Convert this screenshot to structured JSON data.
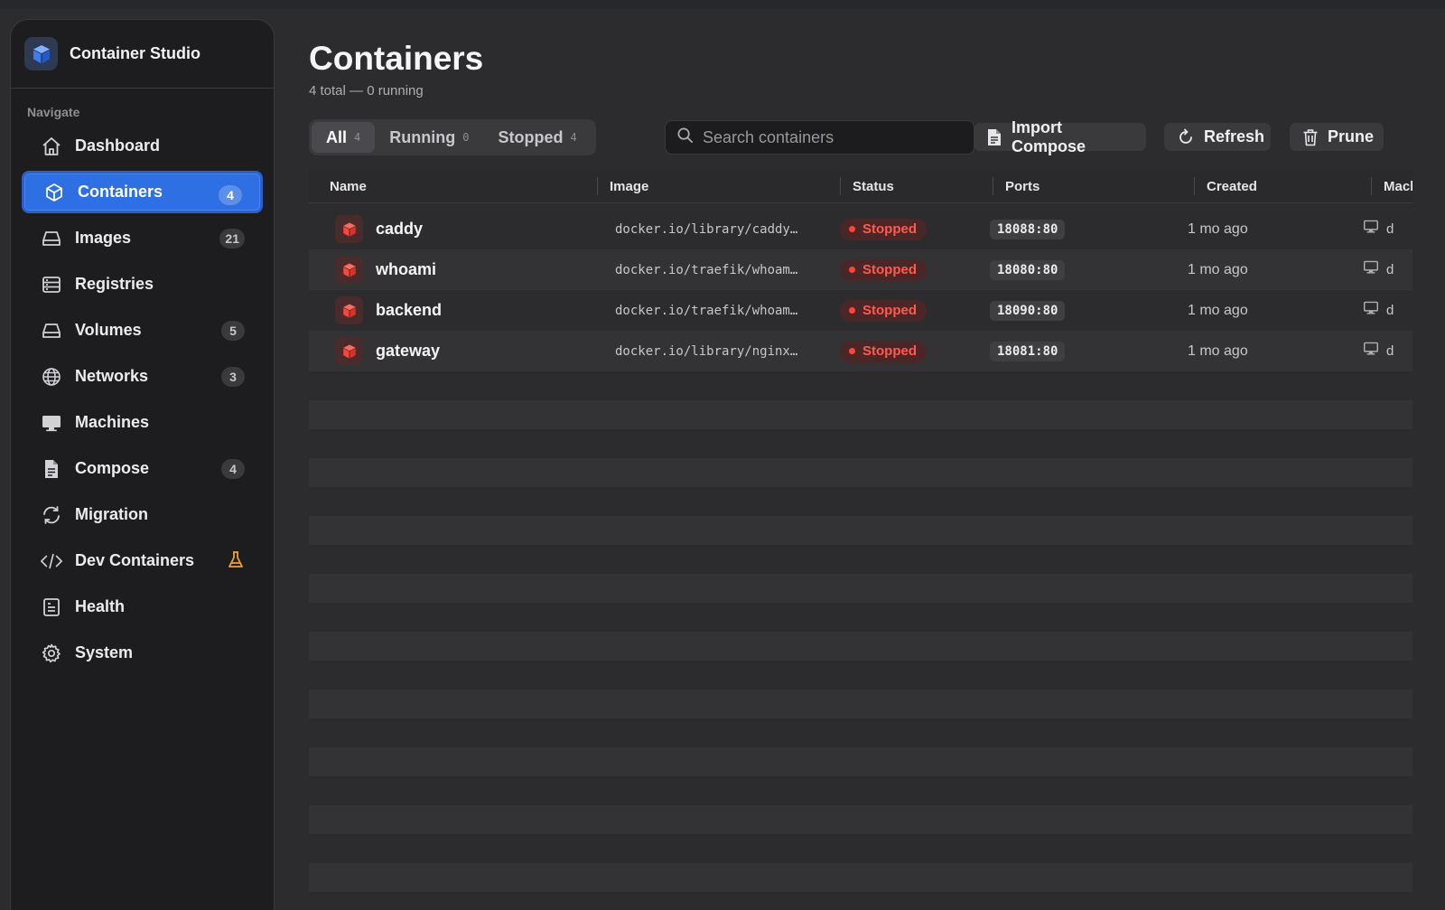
{
  "app": {
    "name": "Container Studio"
  },
  "sidebar": {
    "heading": "Navigate",
    "items": [
      {
        "label": "Dashboard",
        "icon": "house-icon",
        "badge": null
      },
      {
        "label": "Containers",
        "icon": "cube-icon",
        "badge": "4",
        "active": true
      },
      {
        "label": "Images",
        "icon": "drive-icon",
        "badge": "21"
      },
      {
        "label": "Registries",
        "icon": "server-rack-icon",
        "badge": null
      },
      {
        "label": "Volumes",
        "icon": "disk-icon",
        "badge": "5"
      },
      {
        "label": "Networks",
        "icon": "globe-icon",
        "badge": "3"
      },
      {
        "label": "Machines",
        "icon": "monitor-icon",
        "badge": null
      },
      {
        "label": "Compose",
        "icon": "document-icon",
        "badge": "4"
      },
      {
        "label": "Migration",
        "icon": "sync-arrows-icon",
        "badge": null
      },
      {
        "label": "Dev Containers",
        "icon": "code-brackets-icon",
        "badge": null,
        "flag": "flask-icon"
      },
      {
        "label": "Health",
        "icon": "report-icon",
        "badge": null
      },
      {
        "label": "System",
        "icon": "gear-icon",
        "badge": null
      }
    ]
  },
  "header": {
    "title": "Containers",
    "subtitle": "4 total — 0 running"
  },
  "filters": [
    {
      "label": "All",
      "count": "4",
      "active": true
    },
    {
      "label": "Running",
      "count": "0"
    },
    {
      "label": "Stopped",
      "count": "4"
    }
  ],
  "search": {
    "placeholder": "Search containers",
    "value": ""
  },
  "toolbar": {
    "import_label": "Import Compose",
    "refresh_label": "Refresh",
    "prune_label": "Prune"
  },
  "table": {
    "columns": [
      "Name",
      "Image",
      "Status",
      "Ports",
      "Created",
      "Machine"
    ],
    "rows": [
      {
        "name": "caddy",
        "image": "docker.io/library/caddy…",
        "status": "Stopped",
        "ports": "18088:80",
        "created": "1 mo ago",
        "machine": "d"
      },
      {
        "name": "whoami",
        "image": "docker.io/traefik/whoam…",
        "status": "Stopped",
        "ports": "18080:80",
        "created": "1 mo ago",
        "machine": "d"
      },
      {
        "name": "backend",
        "image": "docker.io/traefik/whoam…",
        "status": "Stopped",
        "ports": "18090:80",
        "created": "1 mo ago",
        "machine": "d"
      },
      {
        "name": "gateway",
        "image": "docker.io/library/nginx…",
        "status": "Stopped",
        "ports": "18081:80",
        "created": "1 mo ago",
        "machine": "d"
      }
    ]
  },
  "colors": {
    "accent": "#2f6fe4",
    "stopped": "#ff453a",
    "warning": "#f0a030",
    "background": "#2c2c2e",
    "sidebar": "#1d1d1f"
  }
}
